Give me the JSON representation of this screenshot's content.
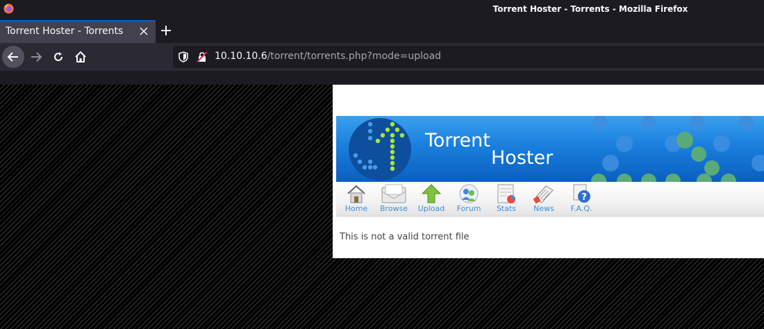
{
  "window": {
    "title": "Torrent Hoster - Torrents - Mozilla Firefox"
  },
  "tabs": [
    {
      "label": "Torrent Hoster - Torrents"
    }
  ],
  "navigation": {
    "url_host": "10.10.10.6",
    "url_path": "/torrent/torrents.php?mode=upload"
  },
  "banner": {
    "line1": "Torrent",
    "line2": "Hoster"
  },
  "menu": {
    "items": [
      {
        "label": "Home",
        "icon": "home-icon"
      },
      {
        "label": "Browse",
        "icon": "browse-icon"
      },
      {
        "label": "Upload",
        "icon": "upload-icon"
      },
      {
        "label": "Forum",
        "icon": "forum-icon"
      },
      {
        "label": "Stats",
        "icon": "stats-icon"
      },
      {
        "label": "News",
        "icon": "news-icon"
      },
      {
        "label": "F.A.Q.",
        "icon": "faq-icon"
      }
    ]
  },
  "main": {
    "message": "This is not a valid torrent file"
  },
  "colors": {
    "accent": "#0060df",
    "link": "#3b8fd6",
    "banner": "#1a7fdc"
  }
}
